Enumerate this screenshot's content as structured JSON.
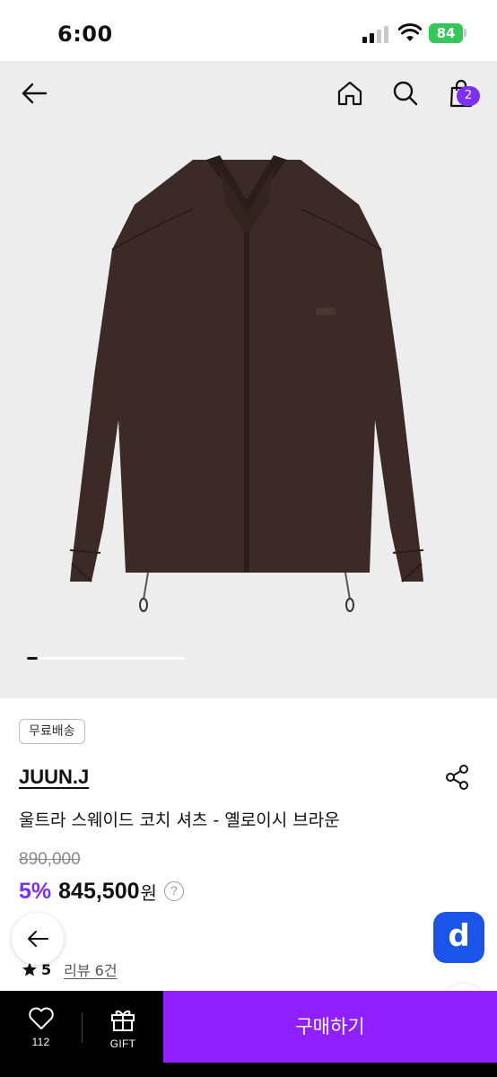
{
  "status_bar": {
    "time": "6:00",
    "battery": "84"
  },
  "header": {
    "back_icon": "arrow-left-icon",
    "home_icon": "home-icon",
    "search_icon": "search-icon",
    "cart_icon": "shopping-bag-icon",
    "cart_count": "2"
  },
  "gallery": {
    "current_index": 1,
    "progress_fraction": 0.07
  },
  "product": {
    "shipping_badge": "무료배송",
    "brand": "JUUN.J",
    "title": "울트라 스웨이드 코치 셔츠 - 옐로이시 브라운",
    "original_price": "890,000",
    "discount": "5%",
    "price": "845,500",
    "currency": "원",
    "help": "?",
    "rating": "5",
    "reviews": "리뷰 6건"
  },
  "floating": {
    "d_label": "d"
  },
  "bottom_bar": {
    "like_count": "112",
    "gift_label": "GIFT",
    "buy_label": "구매하기"
  },
  "colors": {
    "accent": "#8f1fff",
    "badge": "#7b2ff7",
    "d_button": "#1a54e8"
  }
}
